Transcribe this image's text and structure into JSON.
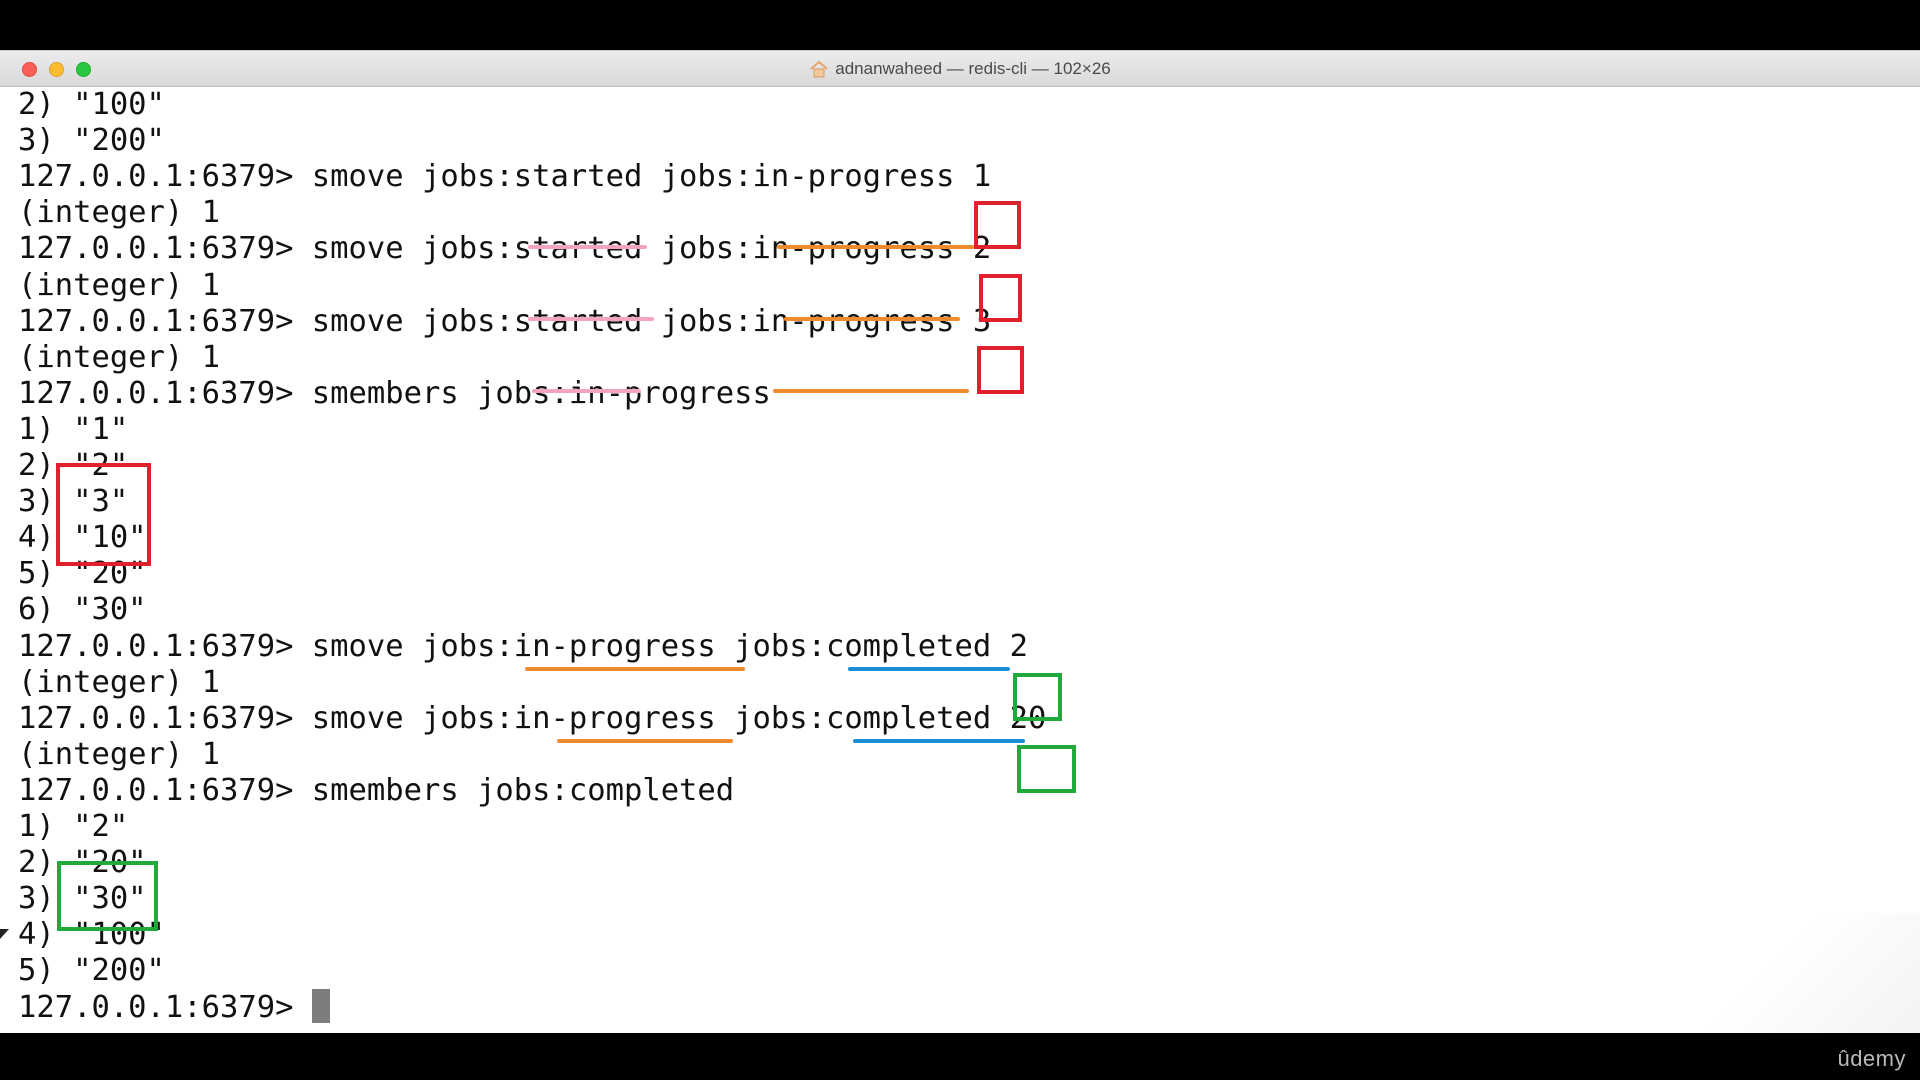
{
  "window": {
    "title": "adnanwaheed — redis-cli — 102×26",
    "home_icon": "home-icon"
  },
  "terminal": {
    "lines": [
      "2) \"100\"",
      "3) \"200\"",
      "127.0.0.1:6379> smove jobs:started jobs:in-progress 1",
      "(integer) 1",
      "127.0.0.1:6379> smove jobs:started jobs:in-progress 2",
      "(integer) 1",
      "127.0.0.1:6379> smove jobs:started jobs:in-progress 3",
      "(integer) 1",
      "127.0.0.1:6379> smembers jobs:in-progress",
      "1) \"1\"",
      "2) \"2\"",
      "3) \"3\"",
      "4) \"10\"",
      "5) \"20\"",
      "6) \"30\"",
      "127.0.0.1:6379> smove jobs:in-progress jobs:completed 2",
      "(integer) 1",
      "127.0.0.1:6379> smove jobs:in-progress jobs:completed 20",
      "(integer) 1",
      "127.0.0.1:6379> smembers jobs:completed",
      "1) \"2\"",
      "2) \"20\"",
      "3) \"30\"",
      "4) \"100\"",
      "5) \"200\"",
      "127.0.0.1:6379> "
    ],
    "prompt_line_index": 25
  },
  "annotations": {
    "colors": {
      "red_box": "#e0202c",
      "green_box": "#22a93c",
      "pink_underline": "#f5a3c1",
      "orange_underline": "#f08a2c",
      "blue_underline": "#1a8ed6"
    }
  },
  "watermark": {
    "label": "ûdemy"
  }
}
